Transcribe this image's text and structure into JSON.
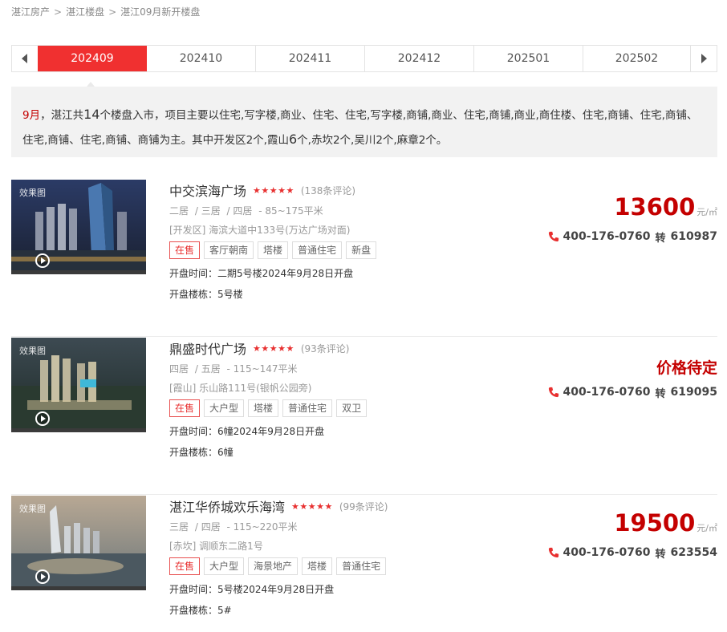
{
  "breadcrumb": [
    "湛江房产",
    "湛江楼盘",
    "湛江09月新开楼盘"
  ],
  "breadcrumb_sep": ">",
  "month_tabs": [
    "202409",
    "202410",
    "202411",
    "202412",
    "202501",
    "202502"
  ],
  "active_tab": "202409",
  "summary": {
    "month": "9月",
    "text_a": "，湛江共",
    "count": "14",
    "text_b": "个楼盘入市，项目主要以住宅,写字楼,商业、住宅、住宅,写字楼,商铺,商业、住宅,商铺,商业,商住楼、住宅,商铺、住宅,商铺、住宅,商铺、住宅,商铺、商铺为主。其中开发区2个,霞山",
    "xiashan_count": "6",
    "text_c": "个,赤坎2个,吴川2个,麻章2个。"
  },
  "listings": [
    {
      "thumb_tag": "效果图",
      "title": "中交滨海广场",
      "stars": "★★★★★",
      "reviews": "(138条评论)",
      "rooms": [
        "二居",
        "/ 三居",
        "/ 四居"
      ],
      "area": "- 85~175平米",
      "address": "[开发区] 海滨大道中133号(万达广场对面)",
      "badges": [
        "在售",
        "客厅朝南",
        "塔楼",
        "普通住宅",
        "新盘"
      ],
      "open_time_label": "开盘时间：",
      "open_time": "二期5号楼2024年9月28日开盘",
      "building_label": "开盘楼栋：",
      "building": "5号楼",
      "price": "13600",
      "unit": "元/㎡",
      "phone": "400-176-0760",
      "zhuan": "转",
      "ext": "610987"
    },
    {
      "thumb_tag": "效果图",
      "title": "鼎盛时代广场",
      "stars": "★★★★★",
      "reviews": "(93条评论)",
      "rooms": [
        "四居",
        "/ 五居"
      ],
      "area": "- 115~147平米",
      "address": "[霞山] 乐山路111号(银帆公园旁)",
      "badges": [
        "在售",
        "大户型",
        "塔楼",
        "普通住宅",
        "双卫"
      ],
      "open_time_label": "开盘时间：",
      "open_time": "6幢2024年9月28日开盘",
      "building_label": "开盘楼栋：",
      "building": "6幢",
      "price_pending": "价格待定",
      "phone": "400-176-0760",
      "zhuan": "转",
      "ext": "619095"
    },
    {
      "thumb_tag": "效果图",
      "title": "湛江华侨城欢乐海湾",
      "stars": "★★★★★",
      "reviews": "(99条评论)",
      "rooms": [
        "三居",
        "/ 四居"
      ],
      "area": "- 115~220平米",
      "address": "[赤坎] 调顺东二路1号",
      "badges": [
        "在售",
        "大户型",
        "海景地产",
        "塔楼",
        "普通住宅"
      ],
      "open_time_label": "开盘时间：",
      "open_time": "5号楼2024年9月28日开盘",
      "building_label": "开盘楼栋：",
      "building": "5#",
      "price": "19500",
      "unit": "元/㎡",
      "phone": "400-176-0760",
      "zhuan": "转",
      "ext": "623554"
    }
  ],
  "colors": {
    "accent": "#f03030",
    "price": "#c40000",
    "star": "#e83030"
  }
}
